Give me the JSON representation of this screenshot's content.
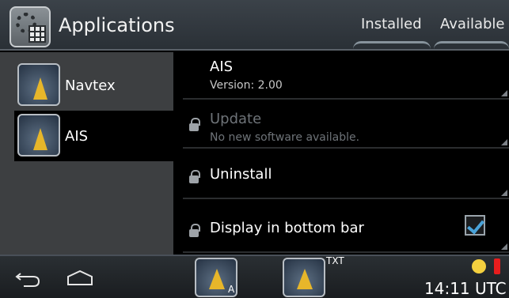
{
  "header": {
    "title": "Applications",
    "tabs": [
      "Installed",
      "Available"
    ]
  },
  "left_list": [
    {
      "label": "Navtex",
      "icon": "navtex-icon",
      "selected": false
    },
    {
      "label": "AIS",
      "icon": "ais-icon",
      "selected": true
    }
  ],
  "settings": {
    "app_name": "AIS",
    "version": "Version: 2.00",
    "update_title": "Update",
    "update_subtitle": "No new software available.",
    "uninstall_title": "Uninstall",
    "display_title": "Display in bottom bar",
    "display_checked": true
  },
  "bottom_bar": {
    "mini_txt": "TXT",
    "mini_a": "A",
    "time": "14:11 UTC"
  },
  "colors": {
    "accent": "#4aa3d9",
    "alert": "#e81d1d",
    "warning": "#f4d03f"
  }
}
